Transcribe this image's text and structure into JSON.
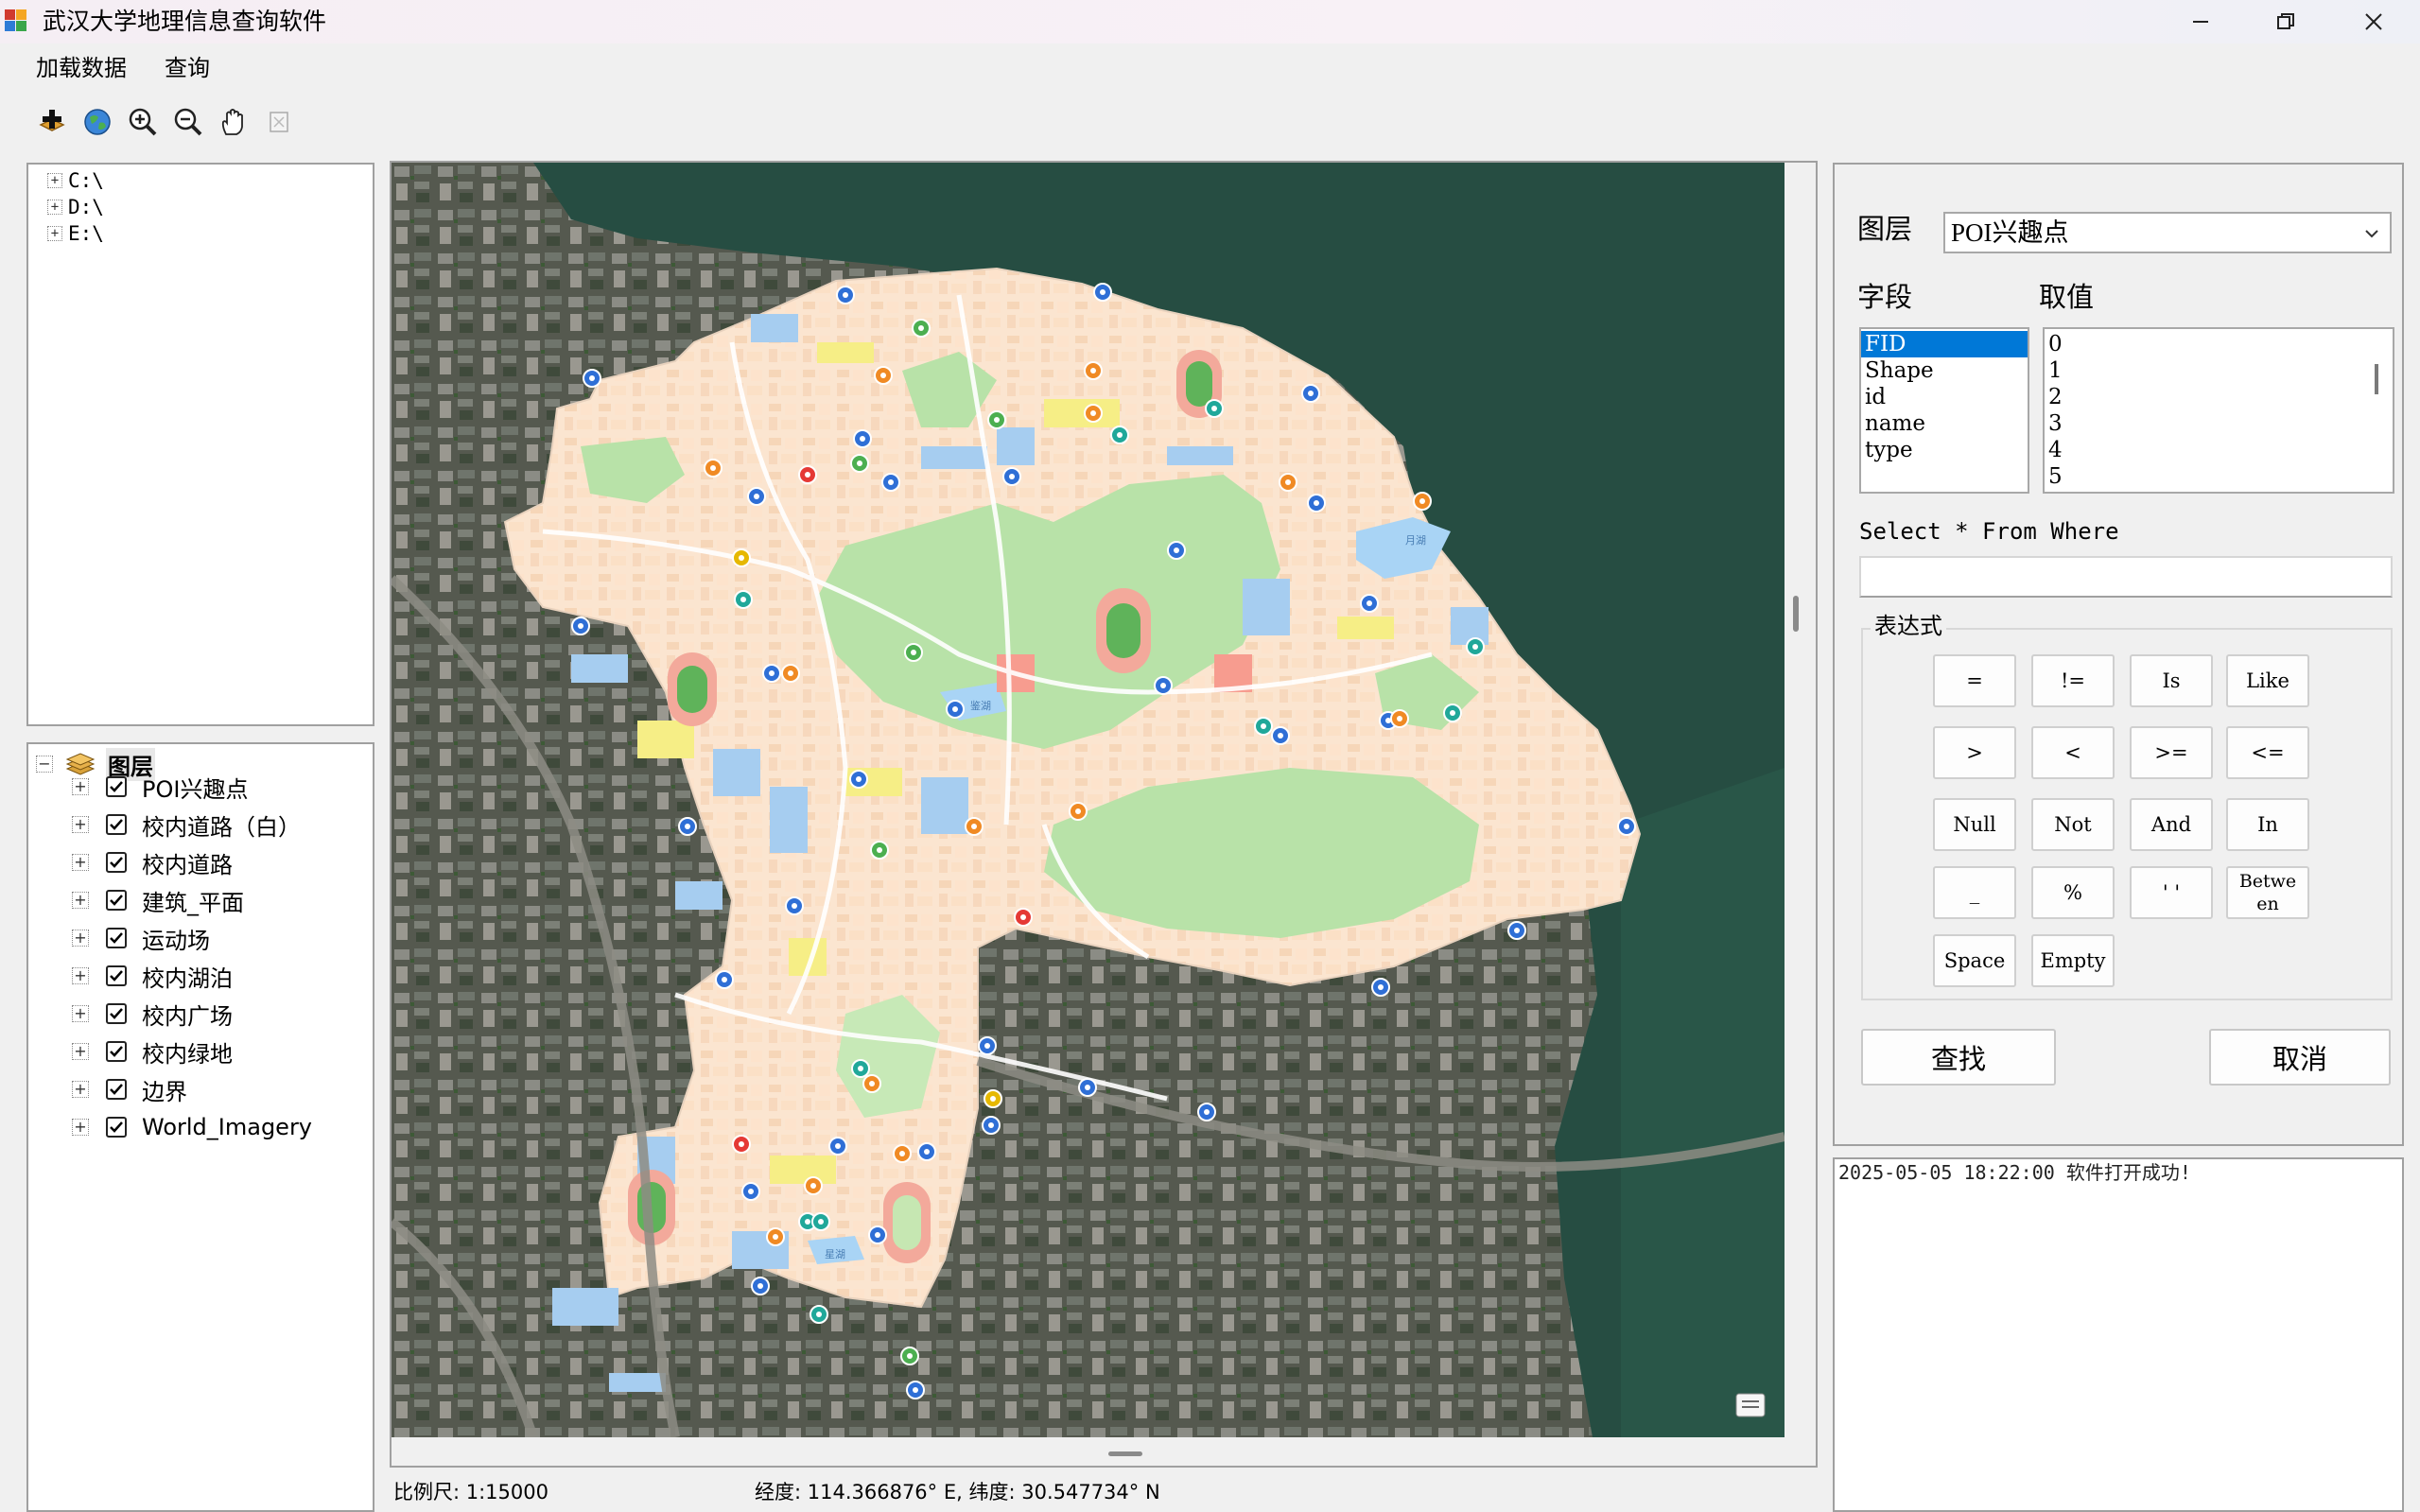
{
  "window": {
    "title": "武汉大学地理信息查询软件"
  },
  "menu": [
    {
      "label": "加载数据"
    },
    {
      "label": "查询"
    }
  ],
  "toolbar": {
    "tools": [
      "add-data-icon",
      "globe-icon",
      "zoom-in-icon",
      "zoom-out-icon",
      "pan-hand-icon",
      "identify-icon"
    ]
  },
  "folder_tree": {
    "items": [
      {
        "label": "C:\\"
      },
      {
        "label": "D:\\"
      },
      {
        "label": "E:\\"
      }
    ]
  },
  "layer_tree": {
    "root": "图层",
    "layers": [
      {
        "label": "POI兴趣点",
        "checked": true
      },
      {
        "label": "校内道路（白）",
        "checked": true
      },
      {
        "label": "校内道路",
        "checked": true
      },
      {
        "label": "建筑_平面",
        "checked": true
      },
      {
        "label": "运动场",
        "checked": true
      },
      {
        "label": "校内湖泊",
        "checked": true
      },
      {
        "label": "校内广场",
        "checked": true
      },
      {
        "label": "校内绿地",
        "checked": true
      },
      {
        "label": "边界",
        "checked": true
      },
      {
        "label": "World_Imagery",
        "checked": true
      }
    ]
  },
  "map": {
    "lake_labels": [
      "月湖",
      "鉴湖",
      "星湖"
    ]
  },
  "status": {
    "scale": "比例尺: 1:15000",
    "coords": "经度: 114.366876° E, 纬度: 30.547734° N"
  },
  "query": {
    "layer_label": "图层",
    "layer_value": "POI兴趣点",
    "field_label": "字段",
    "value_label": "取值",
    "fields": [
      "FID",
      "Shape",
      "id",
      "name",
      "type"
    ],
    "selected_field": "FID",
    "values": [
      "0",
      "1",
      "2",
      "3",
      "4",
      "5"
    ],
    "select_text": "Select * From Where",
    "expr_group_label": "表达式",
    "operators": [
      [
        "=",
        "!=",
        "Is",
        "Like"
      ],
      [
        ">",
        "<",
        ">=",
        "<="
      ],
      [
        "Null",
        "Not",
        "And",
        "In"
      ],
      [
        "_",
        "%",
        "' '",
        "Betwe en"
      ],
      [
        "Space",
        "Empty"
      ]
    ],
    "find_label": "查找",
    "cancel_label": "取消"
  },
  "log": {
    "text": "2025-05-05 18:22:00 软件打开成功!"
  },
  "colors": {
    "selection": "#0078d7",
    "water": "#264d42",
    "campus": "#fde8d3",
    "green": "#b7e2a7"
  }
}
